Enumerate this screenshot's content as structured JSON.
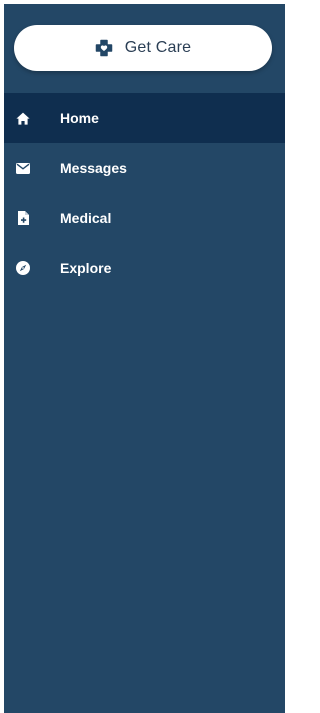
{
  "colors": {
    "sidebar_bg": "#234766",
    "active_bg": "#0f2e4f",
    "button_bg": "#ffffff",
    "button_text": "#2b3f55",
    "icon_accent": "#234766"
  },
  "cta": {
    "label": "Get Care",
    "icon": "medical-cross-heart-icon"
  },
  "nav": {
    "items": [
      {
        "label": "Home",
        "icon": "home-icon",
        "active": true
      },
      {
        "label": "Messages",
        "icon": "envelope-icon",
        "active": false
      },
      {
        "label": "Medical",
        "icon": "medical-file-icon",
        "active": false
      },
      {
        "label": "Explore",
        "icon": "compass-icon",
        "active": false
      }
    ]
  }
}
